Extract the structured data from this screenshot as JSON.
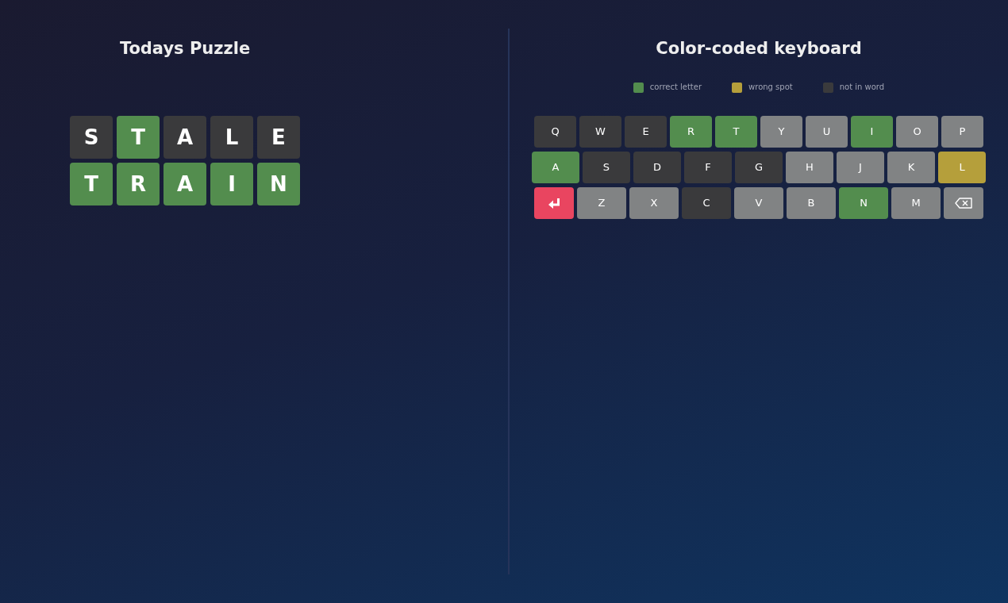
{
  "puzzle": {
    "title": "Todays Puzzle",
    "rows": [
      {
        "tiles": [
          {
            "letter": "S",
            "color": "#3a3a3c"
          },
          {
            "letter": "T",
            "color": "#538d4e"
          },
          {
            "letter": "A",
            "color": "#3a3a3c"
          },
          {
            "letter": "L",
            "color": "#3a3a3c"
          },
          {
            "letter": "E",
            "color": "#3a3a3c"
          }
        ]
      },
      {
        "tiles": [
          {
            "letter": "T",
            "color": "#538d4e"
          },
          {
            "letter": "R",
            "color": "#538d4e"
          },
          {
            "letter": "A",
            "color": "#538d4e"
          },
          {
            "letter": "I",
            "color": "#538d4e"
          },
          {
            "letter": "N",
            "color": "#538d4e"
          }
        ]
      }
    ]
  },
  "keyboard": {
    "title": "Color-coded keyboard",
    "legend": [
      {
        "label": "correct letter",
        "color": "#538d4e"
      },
      {
        "label": "wrong spot",
        "color": "#b59f3b"
      },
      {
        "label": "not in word",
        "color": "#3a3a3c"
      }
    ],
    "rows": [
      {
        "keys": [
          {
            "kind": "letter",
            "label": "Q",
            "color": "#3a3a3c"
          },
          {
            "kind": "letter",
            "label": "W",
            "color": "#3a3a3c"
          },
          {
            "kind": "letter",
            "label": "E",
            "color": "#3a3a3c"
          },
          {
            "kind": "letter",
            "label": "R",
            "color": "#538d4e"
          },
          {
            "kind": "letter",
            "label": "T",
            "color": "#538d4e"
          },
          {
            "kind": "letter",
            "label": "Y",
            "color": "#818384"
          },
          {
            "kind": "letter",
            "label": "U",
            "color": "#818384"
          },
          {
            "kind": "letter",
            "label": "I",
            "color": "#538d4e"
          },
          {
            "kind": "letter",
            "label": "O",
            "color": "#818384"
          },
          {
            "kind": "letter",
            "label": "P",
            "color": "#818384"
          }
        ]
      },
      {
        "keys": [
          {
            "kind": "letter",
            "label": "A",
            "color": "#538d4e"
          },
          {
            "kind": "letter",
            "label": "S",
            "color": "#3a3a3c"
          },
          {
            "kind": "letter",
            "label": "D",
            "color": "#3a3a3c"
          },
          {
            "kind": "letter",
            "label": "F",
            "color": "#3a3a3c"
          },
          {
            "kind": "letter",
            "label": "G",
            "color": "#3a3a3c"
          },
          {
            "kind": "letter",
            "label": "H",
            "color": "#818384"
          },
          {
            "kind": "letter",
            "label": "J",
            "color": "#818384"
          },
          {
            "kind": "letter",
            "label": "K",
            "color": "#818384"
          },
          {
            "kind": "letter",
            "label": "L",
            "color": "#b59f3b"
          }
        ]
      },
      {
        "keys": [
          {
            "kind": "enter"
          },
          {
            "kind": "letter",
            "label": "Z",
            "color": "#818384"
          },
          {
            "kind": "letter",
            "label": "X",
            "color": "#818384"
          },
          {
            "kind": "letter",
            "label": "C",
            "color": "#3a3a3c"
          },
          {
            "kind": "letter",
            "label": "V",
            "color": "#818384"
          },
          {
            "kind": "letter",
            "label": "B",
            "color": "#818384"
          },
          {
            "kind": "letter",
            "label": "N",
            "color": "#538d4e"
          },
          {
            "kind": "letter",
            "label": "M",
            "color": "#818384"
          },
          {
            "kind": "backspace"
          }
        ]
      }
    ]
  }
}
